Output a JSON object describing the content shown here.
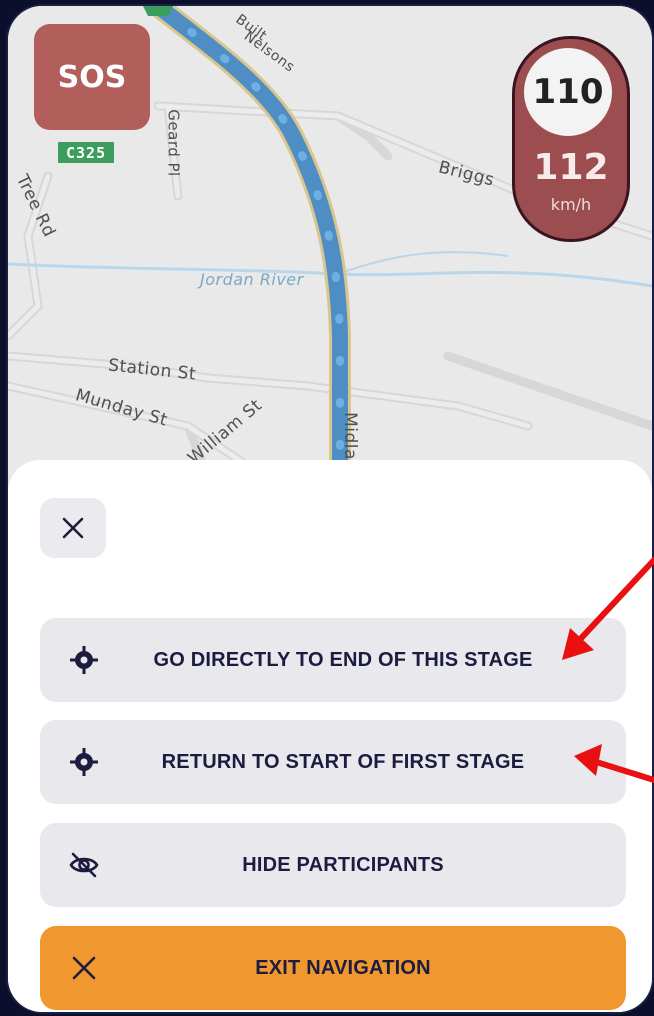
{
  "map": {
    "labels": {
      "nelsons": "Nelsons",
      "builth": "Built",
      "geard": "Geard Pl",
      "briggs": "Briggs",
      "tree_rd": "Tree Rd",
      "jordan_river": "Jordan River",
      "station": "Station St",
      "munday": "Munday St",
      "william": "William St",
      "midland": "Midla"
    },
    "route_shield": "C325"
  },
  "sos_label": "SOS",
  "speed": {
    "limit": "110",
    "current": "112",
    "unit": "km/h"
  },
  "sheet": {
    "close_icon": "close-icon",
    "actions": [
      {
        "label": "GO DIRECTLY TO END OF THIS STAGE",
        "icon": "crosshair-icon"
      },
      {
        "label": "RETURN TO START OF FIRST STAGE",
        "icon": "crosshair-icon"
      },
      {
        "label": "HIDE PARTICIPANTS",
        "icon": "eye-off-icon"
      },
      {
        "label": "EXIT NAVIGATION",
        "icon": "close-icon"
      }
    ]
  },
  "colors": {
    "exit_button": "#f0972f",
    "route_line": "#5b9fd6",
    "annotation_arrow": "#e81010",
    "background": "#0b0f2c"
  }
}
